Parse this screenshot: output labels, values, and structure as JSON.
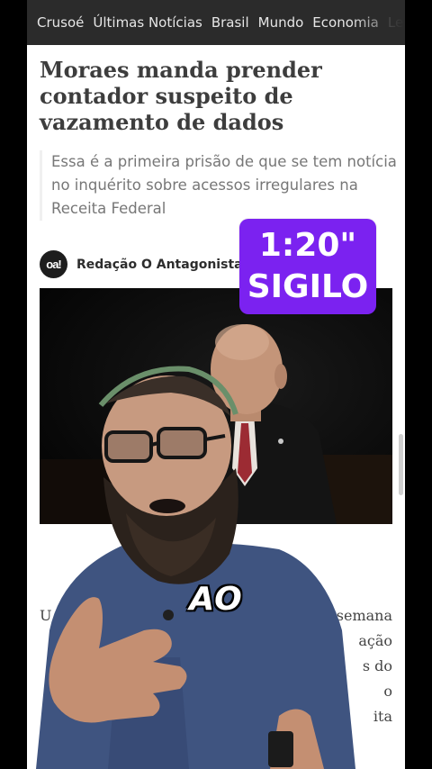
{
  "nav": {
    "items": [
      "Crusoé",
      "Últimas Notícias",
      "Brasil",
      "Mundo",
      "Economia",
      "Le"
    ]
  },
  "article": {
    "title": "Moraes manda prender contador suspeito de vazamento de dados",
    "subtitle": "Essa é a primeira prisão de que se tem notícia no inquérito sobre acessos irregulares na Receita Federal",
    "author": {
      "logo_text": "oa!",
      "name": "Redação O Antagonista"
    },
    "body_fragments": [
      [
        "U",
        "semana"
      ],
      [
        "",
        "ação"
      ],
      [
        "",
        "s do"
      ],
      [
        "",
        "o"
      ],
      [
        "",
        "ita"
      ]
    ]
  },
  "sticker": {
    "line1": "1:20\"",
    "line2": "SIGILO",
    "color": "#7b22f0"
  },
  "caption": {
    "text": "AO"
  },
  "colors": {
    "nav_bg": "#2b2b2b",
    "page_bg": "#ffffff",
    "title": "#3d3d3d",
    "subtitle": "#777777",
    "shirt": "#3f5480"
  }
}
